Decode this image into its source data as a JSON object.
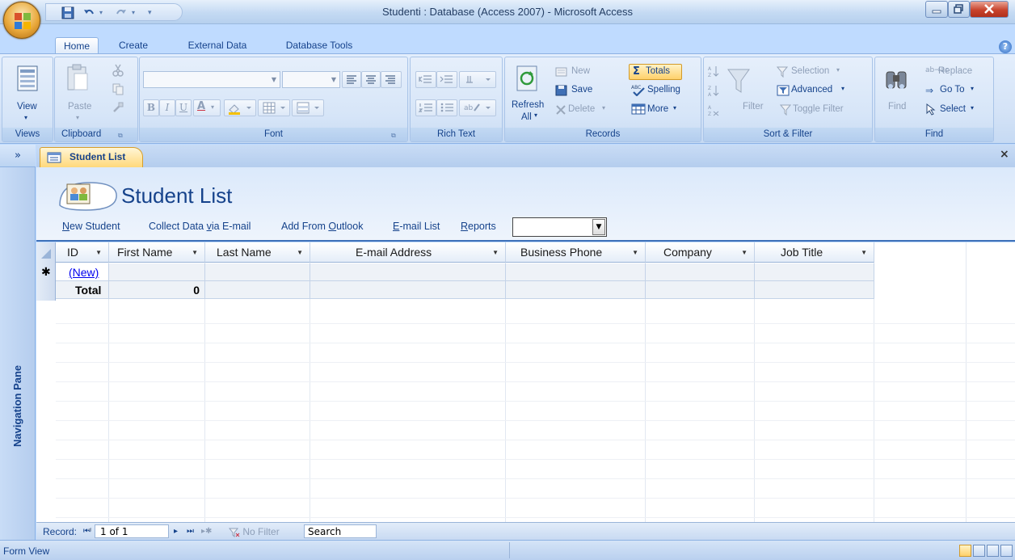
{
  "window": {
    "title": "Studenti : Database (Access 2007) - Microsoft Access"
  },
  "ribbon_tabs": [
    "Home",
    "Create",
    "External Data",
    "Database Tools"
  ],
  "ribbon": {
    "views": {
      "label": "Views",
      "view": "View"
    },
    "clipboard": {
      "label": "Clipboard",
      "paste": "Paste"
    },
    "font": {
      "label": "Font",
      "bold": "B",
      "italic": "I",
      "underline": "U",
      "font_color": "A"
    },
    "rich_text": {
      "label": "Rich Text"
    },
    "records": {
      "label": "Records",
      "refresh": "Refresh",
      "refresh_all": "All",
      "new": "New",
      "save": "Save",
      "delete": "Delete",
      "totals": "Totals",
      "spelling": "Spelling",
      "more": "More"
    },
    "sort_filter": {
      "label": "Sort & Filter",
      "filter": "Filter",
      "selection": "Selection",
      "advanced": "Advanced",
      "toggle_filter": "Toggle Filter"
    },
    "find": {
      "label": "Find",
      "find": "Find",
      "replace": "Replace",
      "goto": "Go To",
      "select": "Select"
    }
  },
  "nav_pane": {
    "label": "Navigation Pane",
    "toggle": "»"
  },
  "document_tab": {
    "title": "Student List",
    "close": "×"
  },
  "form": {
    "title": "Student List",
    "actions": {
      "new_student": {
        "pre": "",
        "u": "N",
        "post": "ew Student"
      },
      "collect": {
        "pre": "Collect Data ",
        "u": "v",
        "post": "ia E-mail"
      },
      "outlook": {
        "pre": "Add From ",
        "u": "O",
        "post": "utlook"
      },
      "email_list": {
        "pre": "",
        "u": "E",
        "post": "-mail List"
      },
      "reports": {
        "pre": "",
        "u": "R",
        "post": "eports"
      }
    },
    "reports_combo_value": ""
  },
  "datasheet": {
    "columns": [
      "ID",
      "First Name",
      "Last Name",
      "E-mail Address",
      "Business Phone",
      "Company",
      "Job Title"
    ],
    "new_row": {
      "id": "(New)"
    },
    "total_row": {
      "label": "Total",
      "first_name": "0"
    }
  },
  "record_nav": {
    "label": "Record:",
    "position": "1 of 1",
    "filter": "No Filter",
    "search": "Search"
  },
  "status": {
    "text": "Form View"
  },
  "colors": {
    "ribbon_bg": "#d4e3f7",
    "accent": "#15428b",
    "tab_highlight": "#ffd87a",
    "new_link": "#0000ee"
  }
}
